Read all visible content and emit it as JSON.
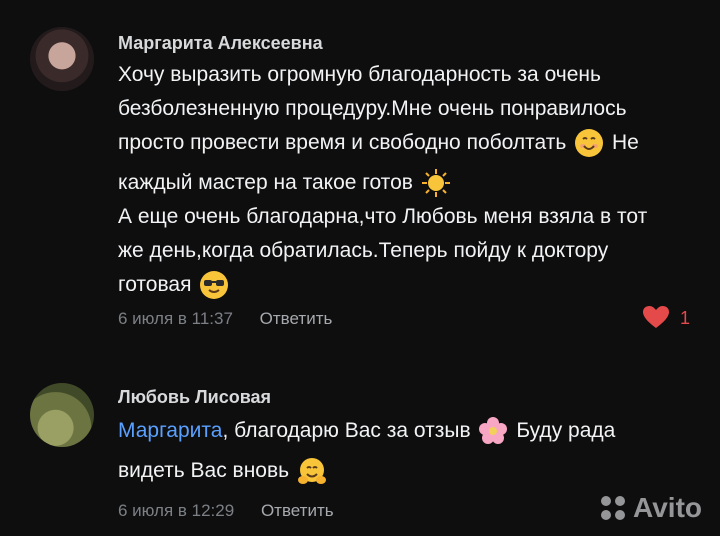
{
  "comments": [
    {
      "author": "Маргарита Алексеевна",
      "lines": [
        "Хочу выразить огромную благодарность за очень",
        "безболезненную процедуру.Мне очень понравилось",
        "просто провести время и свободно поболтать",
        "Не",
        "каждый мастер на такое готов",
        "А еще очень благодарна,что Любовь меня взяла в тот",
        "же день,когда обратилась.Теперь пойду к доктору",
        "готовая"
      ],
      "time": "6 июля в 11:37",
      "reply": "Ответить",
      "likes": "1"
    },
    {
      "author": "Любовь Лисовая",
      "mention": "Маргарита",
      "text1": ", благодарю Вас за отзыв",
      "text2": "Буду рада",
      "text3": "видеть Вас вновь",
      "time": "6 июля в 12:29",
      "reply": "Ответить"
    }
  ],
  "watermark": "Avito",
  "colors": {
    "background": "#0e0e0f",
    "mention": "#5aa0ff",
    "like": "#e44a4a"
  }
}
